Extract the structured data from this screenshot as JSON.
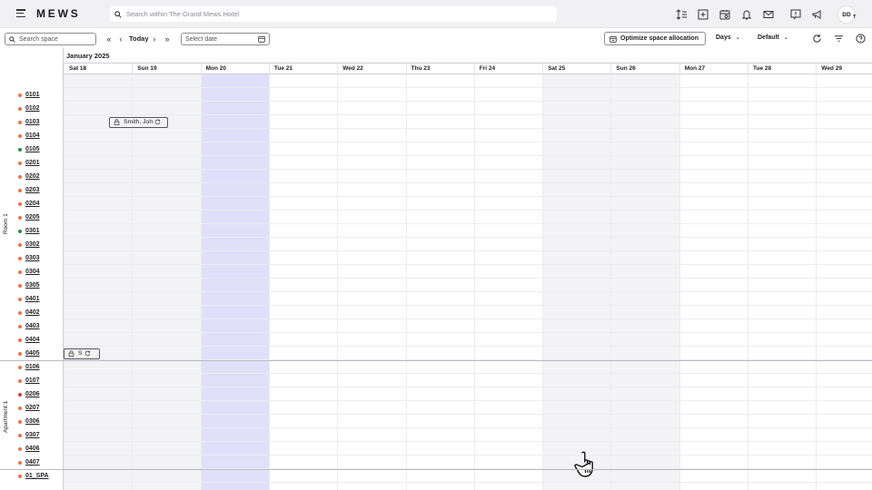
{
  "app": {
    "logo": "MEWS",
    "search_placeholder": "Search within The Grand Mews Hotel",
    "user_initials": "DD",
    "user_sub": "T"
  },
  "toolbar": {
    "search_placeholder": "Search space",
    "first_label": "«",
    "prev_label": "‹",
    "today_label": "Today",
    "next_label": "›",
    "last_label": "»",
    "date_placeholder": "Select date",
    "optimize_label": "Optimize space allocation",
    "view_mode": "Days",
    "preset": "Default"
  },
  "calendar": {
    "month": "January 2025",
    "days": [
      "Sat 18",
      "Sun 19",
      "Mon 20",
      "Tue 21",
      "Wed 22",
      "Thu 23",
      "Fri 24",
      "Sat 25",
      "Sun 26",
      "Mon 27",
      "Tue 28",
      "Wed 29"
    ],
    "highlight_day": "Mon 20",
    "weekend_days": [
      "Sat 18",
      "Sun 19",
      "Sat 25",
      "Sun 26"
    ]
  },
  "sections": [
    {
      "name": "Room 1",
      "rooms": [
        {
          "num": "0101",
          "status": "orange"
        },
        {
          "num": "0102",
          "status": "orange"
        },
        {
          "num": "0103",
          "status": "orange"
        },
        {
          "num": "0104",
          "status": "orange"
        },
        {
          "num": "0105",
          "status": "green"
        },
        {
          "num": "0201",
          "status": "orange"
        },
        {
          "num": "0202",
          "status": "orange"
        },
        {
          "num": "0203",
          "status": "orange"
        },
        {
          "num": "0204",
          "status": "orange"
        },
        {
          "num": "0205",
          "status": "orange"
        },
        {
          "num": "0301",
          "status": "green"
        },
        {
          "num": "0302",
          "status": "orange"
        },
        {
          "num": "0303",
          "status": "orange"
        },
        {
          "num": "0304",
          "status": "orange"
        },
        {
          "num": "0305",
          "status": "orange"
        },
        {
          "num": "0401",
          "status": "orange"
        },
        {
          "num": "0402",
          "status": "orange"
        },
        {
          "num": "0403",
          "status": "orange"
        },
        {
          "num": "0404",
          "status": "orange"
        },
        {
          "num": "0405",
          "status": "orange"
        }
      ]
    },
    {
      "name": "Apartment 1",
      "rooms": [
        {
          "num": "0106",
          "status": "orange"
        },
        {
          "num": "0107",
          "status": "orange"
        },
        {
          "num": "0206",
          "status": "red"
        },
        {
          "num": "0207",
          "status": "orange"
        },
        {
          "num": "0306",
          "status": "orange"
        },
        {
          "num": "0307",
          "status": "orange"
        },
        {
          "num": "0406",
          "status": "orange"
        },
        {
          "num": "0407",
          "status": "orange"
        }
      ]
    },
    {
      "name": "",
      "rooms": [
        {
          "num": "01_SPA",
          "status": "orange"
        }
      ]
    }
  ],
  "reservations": [
    {
      "room": "0103",
      "name": "Smith, Joh"
    },
    {
      "room": "0405",
      "name": "S"
    }
  ],
  "colors": {
    "orange": "#e8744a",
    "green": "#2e8b3e",
    "red": "#c9413a",
    "highlight": "#e0e0fb",
    "weekend": "#f3f3f6"
  }
}
